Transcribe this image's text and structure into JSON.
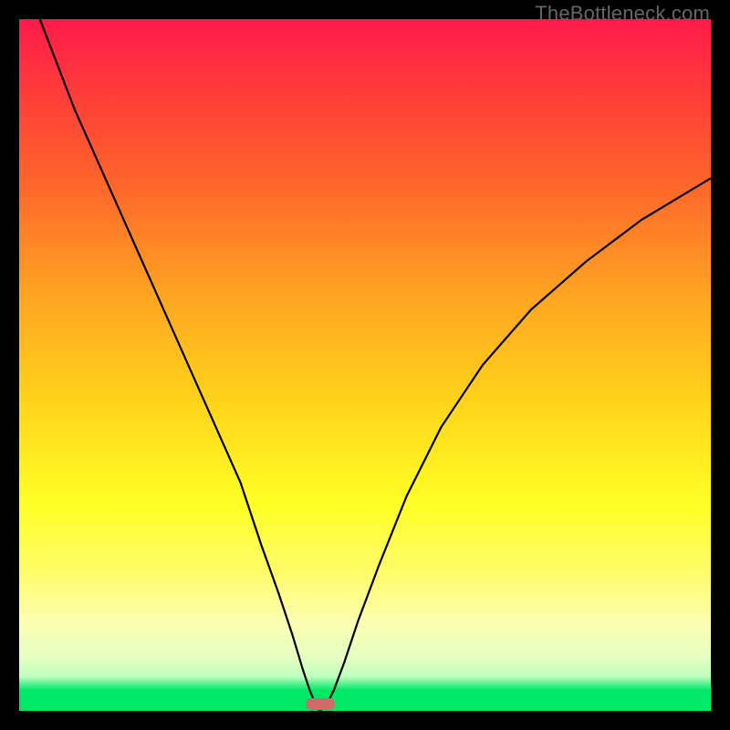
{
  "watermark": "TheBottleneck.com",
  "chart_data": {
    "type": "line",
    "title": "",
    "xlabel": "",
    "ylabel": "",
    "xlim": [
      0,
      100
    ],
    "ylim": [
      0,
      100
    ],
    "grid": false,
    "series": [
      {
        "name": "curve",
        "x": [
          3,
          8,
          12,
          16,
          20,
          24,
          28,
          32,
          35,
          37.5,
          39.5,
          41,
          42,
          42.8,
          43.3,
          43.7,
          44.5,
          45.5,
          47,
          49,
          52,
          56,
          61,
          67,
          74,
          82,
          90,
          100
        ],
        "y": [
          100,
          87,
          78,
          69,
          60,
          51,
          42,
          33,
          24,
          17,
          11,
          6,
          3,
          1,
          0.2,
          0.2,
          1,
          3,
          7,
          13,
          21,
          31,
          41,
          50,
          58,
          65,
          71,
          77
        ]
      }
    ],
    "marker": {
      "x": 43.5,
      "y": 0.5
    },
    "gradient_zones": [
      {
        "color": "#ff1a4b",
        "position": 0
      },
      {
        "color": "#ffa522",
        "position": 40
      },
      {
        "color": "#ffff25",
        "position": 70
      },
      {
        "color": "#00e868",
        "position": 100
      }
    ]
  }
}
